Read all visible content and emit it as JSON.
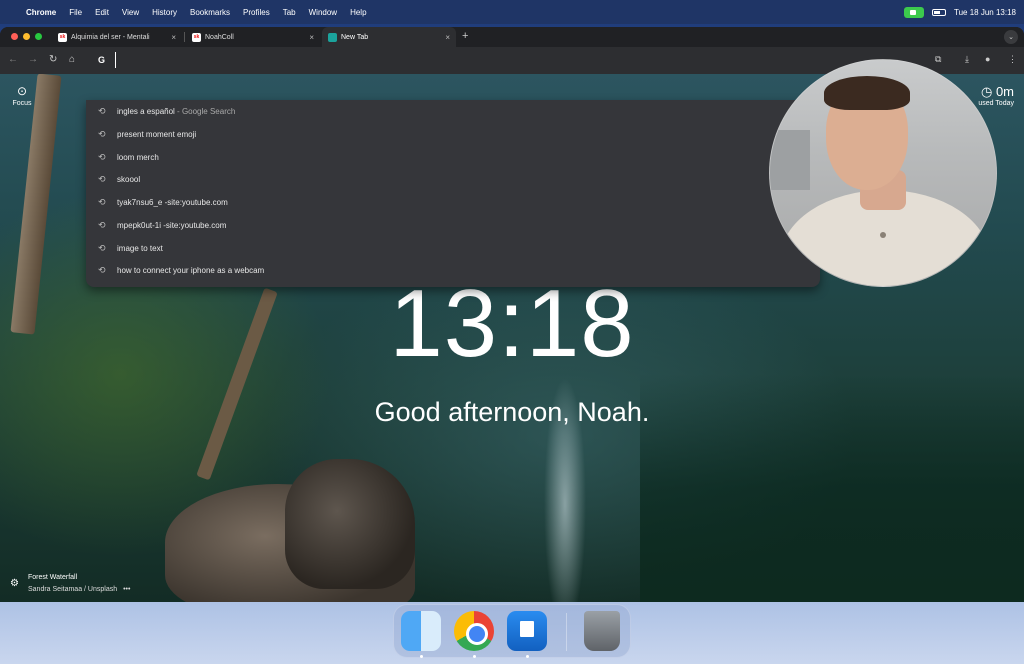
{
  "menubar": {
    "app_name": "Chrome",
    "items": [
      "File",
      "Edit",
      "View",
      "History",
      "Bookmarks",
      "Profiles",
      "Tab",
      "Window",
      "Help"
    ],
    "datetime": "Tue 18 Jun  13:18"
  },
  "tabs": [
    {
      "title": "Alquimia del ser - Mentali",
      "favicon": "sk",
      "active": false
    },
    {
      "title": "NoahColl",
      "favicon": "sk",
      "active": false
    },
    {
      "title": "New Tab",
      "favicon": "",
      "active": true
    }
  ],
  "omnibox": {
    "search_engine_letter": "G",
    "value": ""
  },
  "suggestions": [
    {
      "text": "ingles a español",
      "suffix": " - Google Search"
    },
    {
      "text": "present moment emoji",
      "suffix": ""
    },
    {
      "text": "loom merch",
      "suffix": ""
    },
    {
      "text": "skoool",
      "suffix": ""
    },
    {
      "text": "tyak7nsu6_e -site:youtube.com",
      "suffix": ""
    },
    {
      "text": "mpepk0ut-1i -site:youtube.com",
      "suffix": ""
    },
    {
      "text": "image to text",
      "suffix": ""
    },
    {
      "text": "how to connect your iphone as a webcam",
      "suffix": ""
    }
  ],
  "newtab": {
    "focus_label": "Focus",
    "clock": "13:18",
    "greeting": "Good afternoon, Noah.",
    "timer_value": "0m",
    "timer_sub": "used Today",
    "photo_title": "Forest Waterfall",
    "photo_author": "Sandra Seitamaa / Unsplash",
    "photo_more": "•••"
  },
  "icons": {
    "apple": "",
    "history": "⟲",
    "close": "×",
    "new_tab": "+",
    "back": "←",
    "forward": "→",
    "reload": "↻",
    "home": "⌂",
    "gear": "⚙",
    "extensions": "⧉",
    "download": "⤓",
    "profile": "●",
    "more": "⋮",
    "tab_menu": "⌄",
    "focus": "⊙",
    "timer": "◷"
  }
}
